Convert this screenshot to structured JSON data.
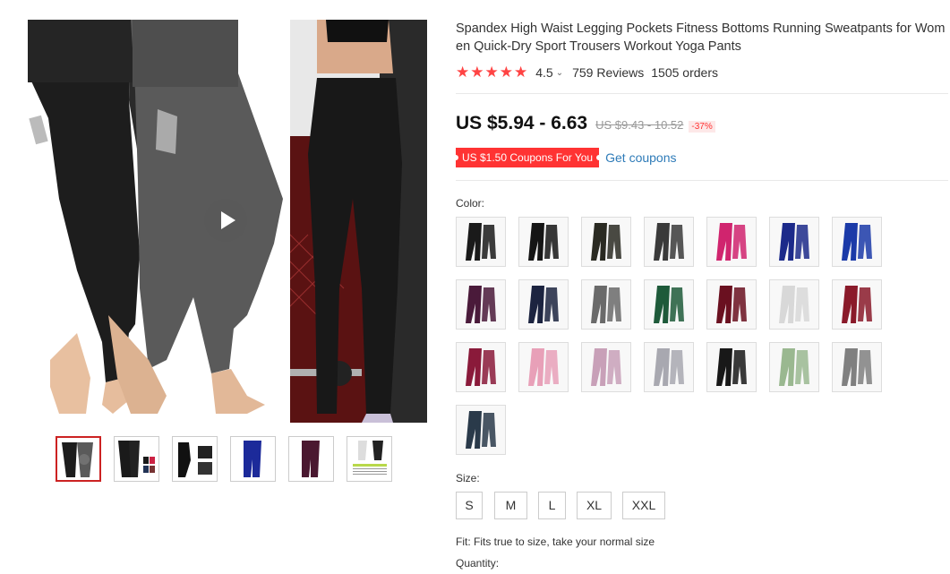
{
  "product": {
    "title": "Spandex High Waist Legging Pockets Fitness Bottoms Running Sweatpants for Women Quick-Dry Sport Trousers Workout Yoga Pants",
    "rating": "4.5",
    "reviews": "759 Reviews",
    "orders": "1505 orders",
    "price": "US $5.94 - 6.63",
    "original_price": "US $9.43 - 10.52",
    "discount": "-37%",
    "coupon_label": "US $1.50 Coupons For You",
    "get_coupons": "Get coupons",
    "color_label": "Color:",
    "size_label": "Size:",
    "sizes": [
      "S",
      "M",
      "L",
      "XL",
      "XXL"
    ],
    "fit_text": "Fit: Fits true to size, take your normal size",
    "quantity_label": "Quantity:"
  },
  "icons": {
    "star": "star-icon",
    "chevron": "chevron-down-icon",
    "play": "play-icon"
  },
  "colors": {
    "accent": "#ff3333",
    "link": "#2e7bb8",
    "selected_thumb_border": "#cc2222"
  },
  "swatch_colors": [
    "#1a1a1a",
    "#151515",
    "#2a2a22",
    "#3a3a3a",
    "#d0246e",
    "#1c2a8a",
    "#1b3aa8",
    "#4a1a3a",
    "#1c2440",
    "#6a6a6a",
    "#1e5a3a",
    "#6a1020",
    "#d8d8d8",
    "#8a1a2a",
    "#8a1a3a",
    "#e8a0b8",
    "#c8a0b8",
    "#a8a8b0",
    "#181818",
    "#9ab890",
    "#808080",
    "#2a3a4a"
  ]
}
